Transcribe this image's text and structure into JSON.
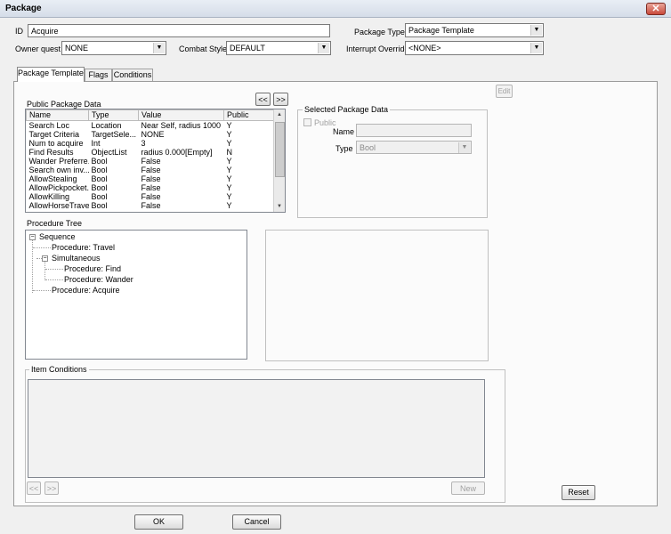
{
  "window": {
    "title": "Package",
    "close_glyph": "✕"
  },
  "form": {
    "id_label": "ID",
    "id_value": "Acquire",
    "package_type_label": "Package Type",
    "package_type_value": "Package Template",
    "owner_quest_label": "Owner quest",
    "owner_quest_value": "NONE",
    "combat_style_label": "Combat Style",
    "combat_style_value": "DEFAULT",
    "interrupt_override_label": "Interrupt Override",
    "interrupt_override_value": "<NONE>"
  },
  "tabs": [
    {
      "label": "Package Template"
    },
    {
      "label": "Flags"
    },
    {
      "label": "Conditions"
    }
  ],
  "edit_button": "Edit",
  "public_data": {
    "title": "Public Package Data",
    "nav_prev": "<<",
    "nav_next": ">>",
    "columns": [
      "Name",
      "Type",
      "Value",
      "Public"
    ],
    "rows": [
      [
        "Search Loc",
        "Location",
        "Near Self, radius 1000",
        "Y"
      ],
      [
        "Target Criteria",
        "TargetSele...",
        " NONE",
        "Y"
      ],
      [
        "Num to acquire",
        "Int",
        "3",
        "Y"
      ],
      [
        "Find Results",
        "ObjectList",
        "radius 0.000[Empty]",
        "N"
      ],
      [
        "Wander Preferre...",
        "Bool",
        "False",
        "Y"
      ],
      [
        "Search own inv...",
        "Bool",
        "False",
        "Y"
      ],
      [
        "AllowStealing",
        "Bool",
        "False",
        "Y"
      ],
      [
        "AllowPickpocket...",
        "Bool",
        "False",
        "Y"
      ],
      [
        "AllowKilling",
        "Bool",
        "False",
        "Y"
      ],
      [
        "AllowHorseTravel",
        "Bool",
        "False",
        "Y"
      ]
    ]
  },
  "selected_data": {
    "title": "Selected Package Data",
    "public_label": "Public",
    "name_label": "Name",
    "name_value": "",
    "type_label": "Type",
    "type_value": "Bool"
  },
  "procedure_tree": {
    "title": "Procedure Tree",
    "nodes": [
      {
        "label": "Sequence",
        "expander": "−"
      },
      {
        "label": "Procedure: Travel"
      },
      {
        "label": "Simultaneous",
        "expander": "−"
      },
      {
        "label": "Procedure: Find"
      },
      {
        "label": "Procedure: Wander"
      },
      {
        "label": "Procedure: Acquire"
      }
    ]
  },
  "item_conditions": {
    "title": "Item Conditions",
    "nav_prev": "<<",
    "nav_next": ">>",
    "new_button": "New"
  },
  "buttons": {
    "reset": "Reset",
    "ok": "OK",
    "cancel": "Cancel"
  }
}
